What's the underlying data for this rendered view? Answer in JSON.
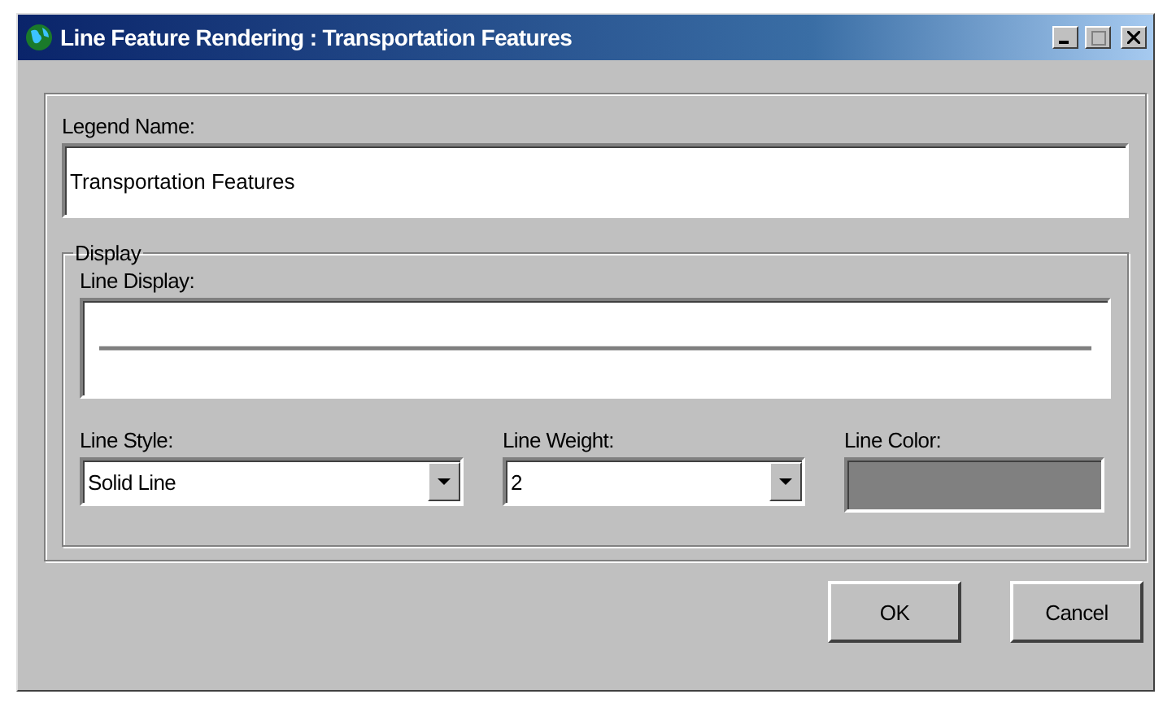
{
  "window": {
    "title": "Line Feature Rendering : Transportation Features"
  },
  "legend_name": {
    "label": "Legend Name:",
    "value": "Transportation Features"
  },
  "display": {
    "title": "Display",
    "line_display_label": "Line Display:",
    "line_style": {
      "label": "Line Style:",
      "value": "Solid Line"
    },
    "line_weight": {
      "label": "Line Weight:",
      "value": "2"
    },
    "line_color": {
      "label": "Line Color:",
      "color": "#808080"
    }
  },
  "buttons": [
    {
      "label": "OK"
    },
    {
      "label": "Cancel"
    }
  ]
}
